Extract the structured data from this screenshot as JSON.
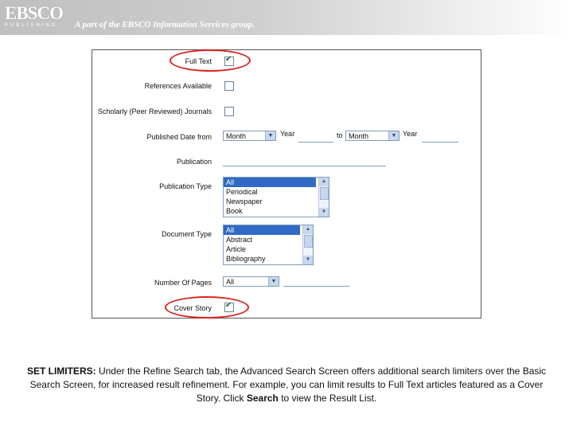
{
  "banner": {
    "logo": "EBSCO",
    "logo_sub": "PUBLISHING",
    "tagline": "A part of the EBSCO Information Services group."
  },
  "form": {
    "full_text": {
      "label": "Full Text",
      "checked": true
    },
    "references": {
      "label": "References Available",
      "checked": false
    },
    "scholarly": {
      "label": "Scholarly (Peer Reviewed) Journals",
      "checked": false
    },
    "published_date": {
      "label": "Published Date from",
      "month_from": "Month",
      "year_label": "Year",
      "to_label": "to",
      "month_to": "Month",
      "year_label_to": "Year"
    },
    "publication": {
      "label": "Publication",
      "value": ""
    },
    "publication_type": {
      "label": "Publication Type",
      "options": [
        "All",
        "Periodical",
        "Newspaper",
        "Book"
      ],
      "selected": "All"
    },
    "document_type": {
      "label": "Document Type",
      "options": [
        "All",
        "Abstract",
        "Article",
        "Bibliography"
      ],
      "selected": "All"
    },
    "number_of_pages": {
      "label": "Number Of Pages",
      "value": "All"
    },
    "cover_story": {
      "label": "Cover Story",
      "checked": true
    },
    "highlight_color": "#d9251c"
  },
  "caption": {
    "title": "SET LIMITERS:",
    "text_1": " Under the Refine Search tab, the Advanced Search Screen offers additional search limiters over the Basic Search Screen, for increased result refinement. For example, you can limit results to Full Text articles featured as a Cover Story. Click ",
    "search_word": "Search",
    "text_2": " to view the Result List."
  }
}
